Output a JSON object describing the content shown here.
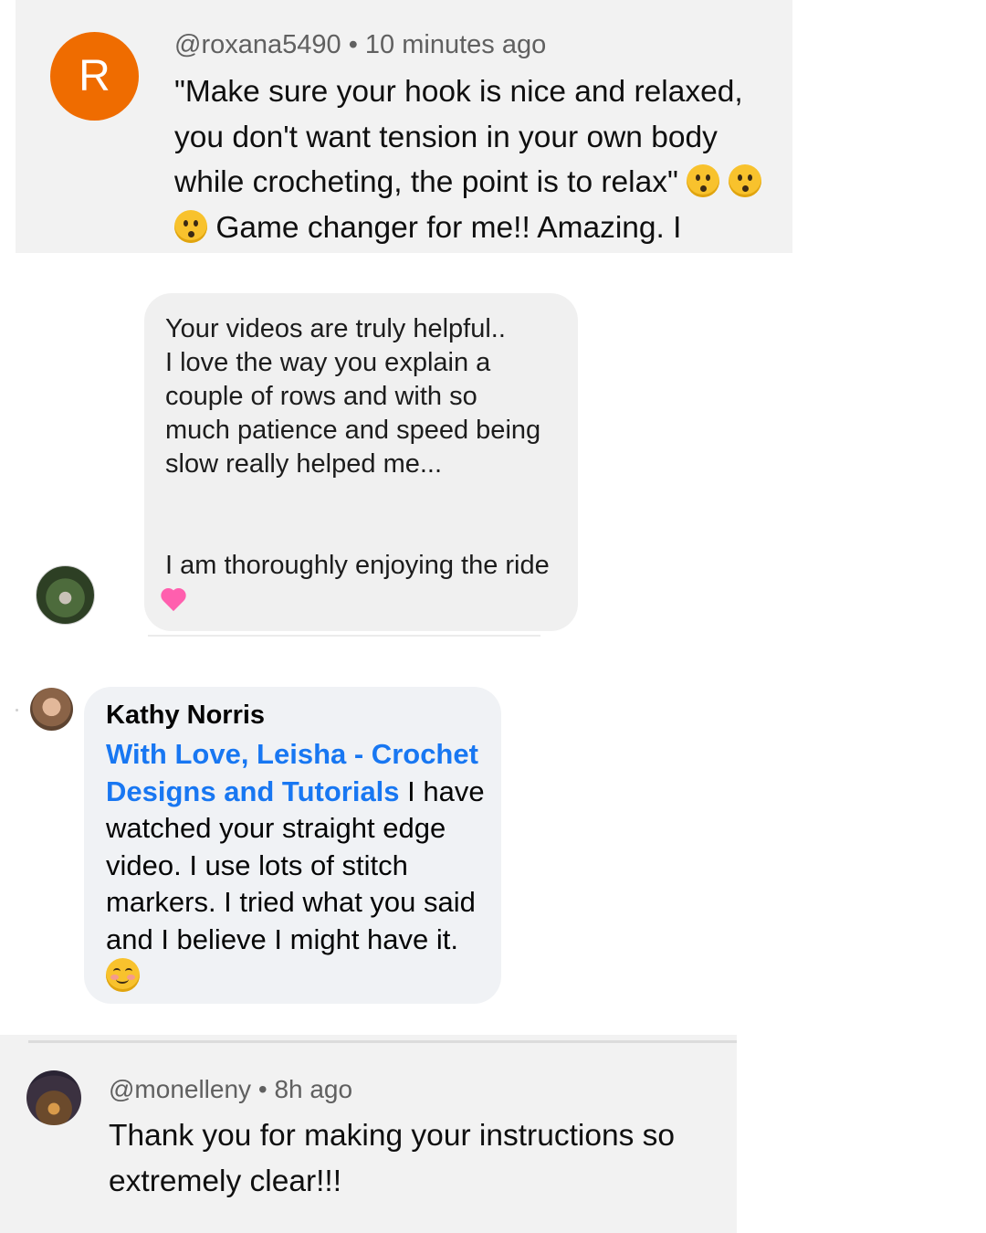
{
  "comment1": {
    "avatar_letter": "R",
    "avatar_color": "#ef6c00",
    "handle": "@roxana5490",
    "separator": "•",
    "time": "10 minutes ago",
    "text_part1": "\"Make sure your hook is nice and relaxed, you don't want tension in your own body while crocheting, the point is to relax\"",
    "emoji": "hushed-face-emoji",
    "text_part2": "Game changer for me!! Amazing. I"
  },
  "comment2": {
    "text_lines": [
      "Your videos are truly helpful..",
      "I love the way you explain a",
      "couple of rows and with so",
      "much patience and speed being",
      "slow really helped me..."
    ],
    "text_last": "I am thoroughly enjoying the ride",
    "emoji": "two-hearts-emoji"
  },
  "comment3": {
    "author": "Kathy Norris",
    "tagged_page": "With Love, Leisha - Crochet Designs and Tutorials",
    "text": " I have watched your straight edge video. I use lots of stitch markers. I tried what you said and I believe I might have it.",
    "emoji": "smiling-face-emoji",
    "link_color": "#1877f2"
  },
  "comment4": {
    "handle": "@monelleny",
    "separator": "•",
    "time": "8h ago",
    "text": "Thank you for making your instructions so extremely clear!!!"
  }
}
